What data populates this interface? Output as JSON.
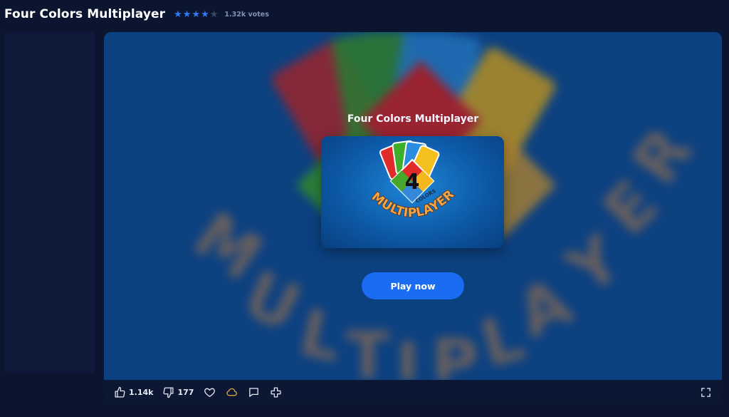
{
  "header": {
    "title": "Four Colors Multiplayer",
    "rating": 4,
    "rating_max": 5,
    "votes": "1.32k votes"
  },
  "game": {
    "name": "Four Colors Multiplayer",
    "logo_number": "4",
    "logo_colors_text": "COLORS",
    "logo_word": "MULTIPLAYER",
    "play_label": "Play now"
  },
  "toolbar": {
    "likes": "1.14k",
    "dislikes": "177",
    "icons": [
      "thumbs-up-icon",
      "thumbs-down-icon",
      "heart-icon",
      "cloud-icon",
      "comment-icon",
      "plus-icon",
      "fullscreen-icon"
    ]
  },
  "colors": {
    "background": "#0b1530",
    "accent": "#1a6cf2",
    "star_on": "#2f7cf6",
    "star_off": "#3d4866",
    "cloud": "#f2b233",
    "card_red": "#e12b2b",
    "card_green": "#3fae2b",
    "card_blue": "#2a8de0",
    "card_yellow": "#f4c01e"
  }
}
